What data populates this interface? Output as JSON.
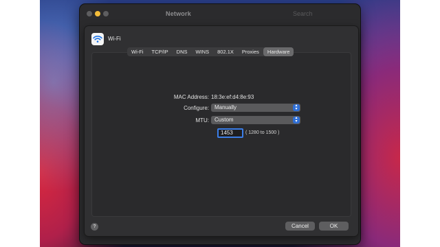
{
  "window": {
    "title": "Network",
    "search_text": "Search"
  },
  "sheet": {
    "title": "Wi-Fi",
    "tabs": [
      {
        "label": "Wi-Fi"
      },
      {
        "label": "TCP/IP"
      },
      {
        "label": "DNS"
      },
      {
        "label": "WINS"
      },
      {
        "label": "802.1X"
      },
      {
        "label": "Proxies"
      },
      {
        "label": "Hardware",
        "selected": true
      }
    ]
  },
  "hardware": {
    "mac_label": "MAC Address:",
    "mac_value": "18:3e:ef:d4:8e:93",
    "configure_label": "Configure:",
    "configure_value": "Manually",
    "mtu_label": "MTU:",
    "mtu_value": "Custom",
    "mtu_input": "1453",
    "mtu_range": "( 1280 to 1500 )"
  },
  "buttons": {
    "help": "?",
    "cancel": "Cancel",
    "ok": "OK"
  },
  "colors": {
    "accent": "#2f6fd6",
    "focus_ring": "#3b7ee8",
    "minimize": "#f4bd3a"
  },
  "icons": {
    "wifi": "wifi-icon",
    "popup_arrows": "updown-chevron-icon"
  }
}
